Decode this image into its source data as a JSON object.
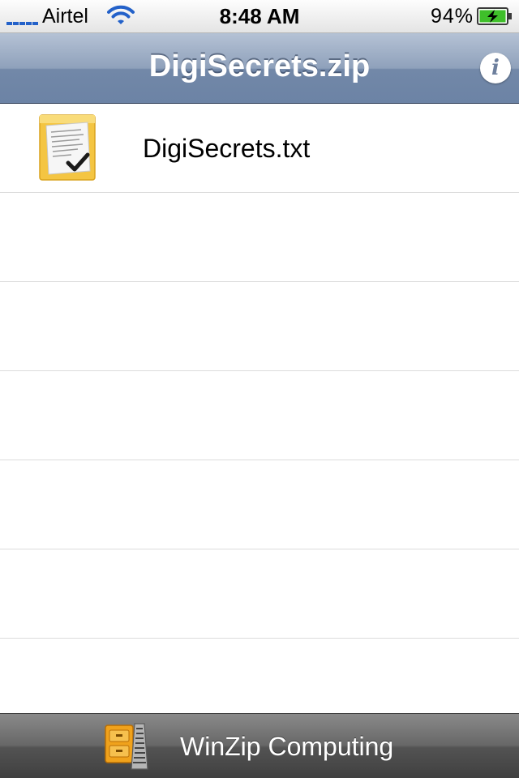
{
  "status_bar": {
    "carrier": "Airtel",
    "time": "8:48 AM",
    "battery_percent": "94%",
    "signal_color": "#2361c9",
    "battery_icon": "battery-charging-icon",
    "wifi_icon": "wifi-icon"
  },
  "nav_bar": {
    "title": "DigiSecrets.zip",
    "info_icon": "info-icon"
  },
  "files": [
    {
      "name": "DigiSecrets.txt",
      "icon": "text-document-icon"
    }
  ],
  "toolbar": {
    "label": "WinZip Computing",
    "logo_icon": "winzip-logo-icon"
  },
  "colors": {
    "nav_bar": "#8fa1bb",
    "toolbar": "#5a5a5a",
    "row_separator": "#dcdcdc"
  }
}
